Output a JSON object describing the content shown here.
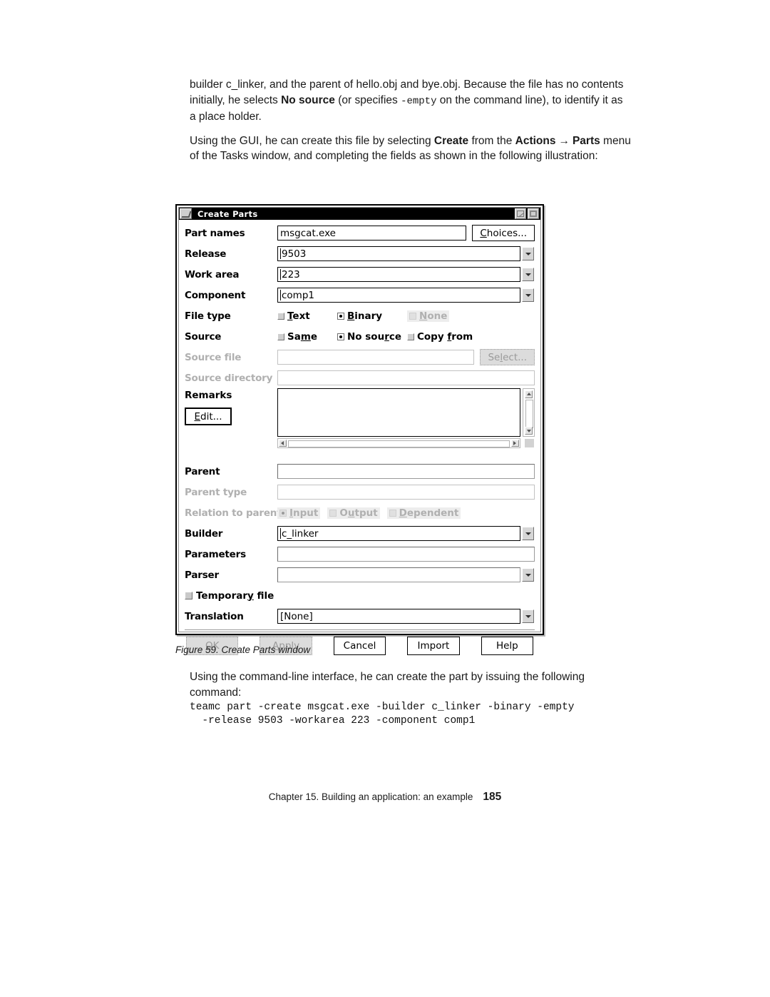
{
  "page": {
    "intro_paragraph_1": {
      "pre": "builder c_linker, and the parent of hello.obj and bye.obj. Because the file has no contents initially, he selects ",
      "bold1": "No source",
      "mid": " (or specifies ",
      "mono1": "-empty",
      "post": " on the command line), to identify it as a place holder."
    },
    "intro_paragraph_2": {
      "pre": "Using the GUI, he can create this file by selecting ",
      "bold1": "Create",
      "mid": " from the ",
      "bold2": "Actions",
      "arrow": "→",
      "bold3": "Parts",
      "post": " menu of the Tasks window, and completing the fields as shown in the following illustration:"
    },
    "figure_caption": "Figure 59. Create Parts window",
    "after_figure_paragraph": "Using the command-line interface, he can create the part by issuing the following command:",
    "command_lines": "teamc part -create msgcat.exe -builder c_linker -binary -empty\n  -release 9503 -workarea 223 -component comp1",
    "footer_text": "Chapter 15. Building an application: an example",
    "page_number": "185"
  },
  "dialog": {
    "title": "Create Parts",
    "titlebar_buttons": [
      "minimize-button",
      "maximize-button"
    ],
    "fields": {
      "part_names": {
        "label": "Part names",
        "value": "msgcat.exe",
        "button": "Choices..."
      },
      "release": {
        "label": "Release",
        "value": "9503"
      },
      "work_area": {
        "label": "Work area",
        "value": "223"
      },
      "component": {
        "label": "Component",
        "value": "comp1"
      },
      "file_type": {
        "label": "File type",
        "options": [
          {
            "label": "Text",
            "selected": false,
            "disabled": false
          },
          {
            "label": "Binary",
            "selected": true,
            "disabled": false
          },
          {
            "label": "None",
            "selected": false,
            "disabled": true
          }
        ]
      },
      "source": {
        "label": "Source",
        "options": [
          {
            "label": "Same",
            "selected": false,
            "disabled": false
          },
          {
            "label": "No source",
            "selected": true,
            "disabled": false
          },
          {
            "label": "Copy from",
            "selected": false,
            "disabled": false
          }
        ]
      },
      "source_file": {
        "label": "Source file",
        "value": "",
        "button": "Select...",
        "disabled": true
      },
      "source_directory": {
        "label": "Source directory",
        "value": "",
        "disabled": true
      },
      "remarks": {
        "label": "Remarks",
        "value": "",
        "edit_button": "Edit..."
      },
      "parent": {
        "label": "Parent",
        "value": ""
      },
      "parent_type": {
        "label": "Parent type",
        "value": "",
        "disabled": true
      },
      "relation_to_parent": {
        "label": "Relation to parent",
        "disabled": true,
        "options": [
          {
            "label": "Input",
            "selected": true
          },
          {
            "label": "Output",
            "selected": false
          },
          {
            "label": "Dependent",
            "selected": false
          }
        ]
      },
      "builder": {
        "label": "Builder",
        "value": "c_linker"
      },
      "parameters": {
        "label": "Parameters",
        "value": ""
      },
      "parser": {
        "label": "Parser",
        "value": ""
      },
      "temporary_file": {
        "label": "Temporary file",
        "checked": false
      },
      "translation": {
        "label": "Translation",
        "value": "[None]"
      }
    },
    "buttons": [
      {
        "label": "OK",
        "disabled": true
      },
      {
        "label": "Apply",
        "disabled": true
      },
      {
        "label": "Cancel",
        "disabled": false
      },
      {
        "label": "Import",
        "disabled": false
      },
      {
        "label": "Help",
        "disabled": false
      }
    ]
  }
}
